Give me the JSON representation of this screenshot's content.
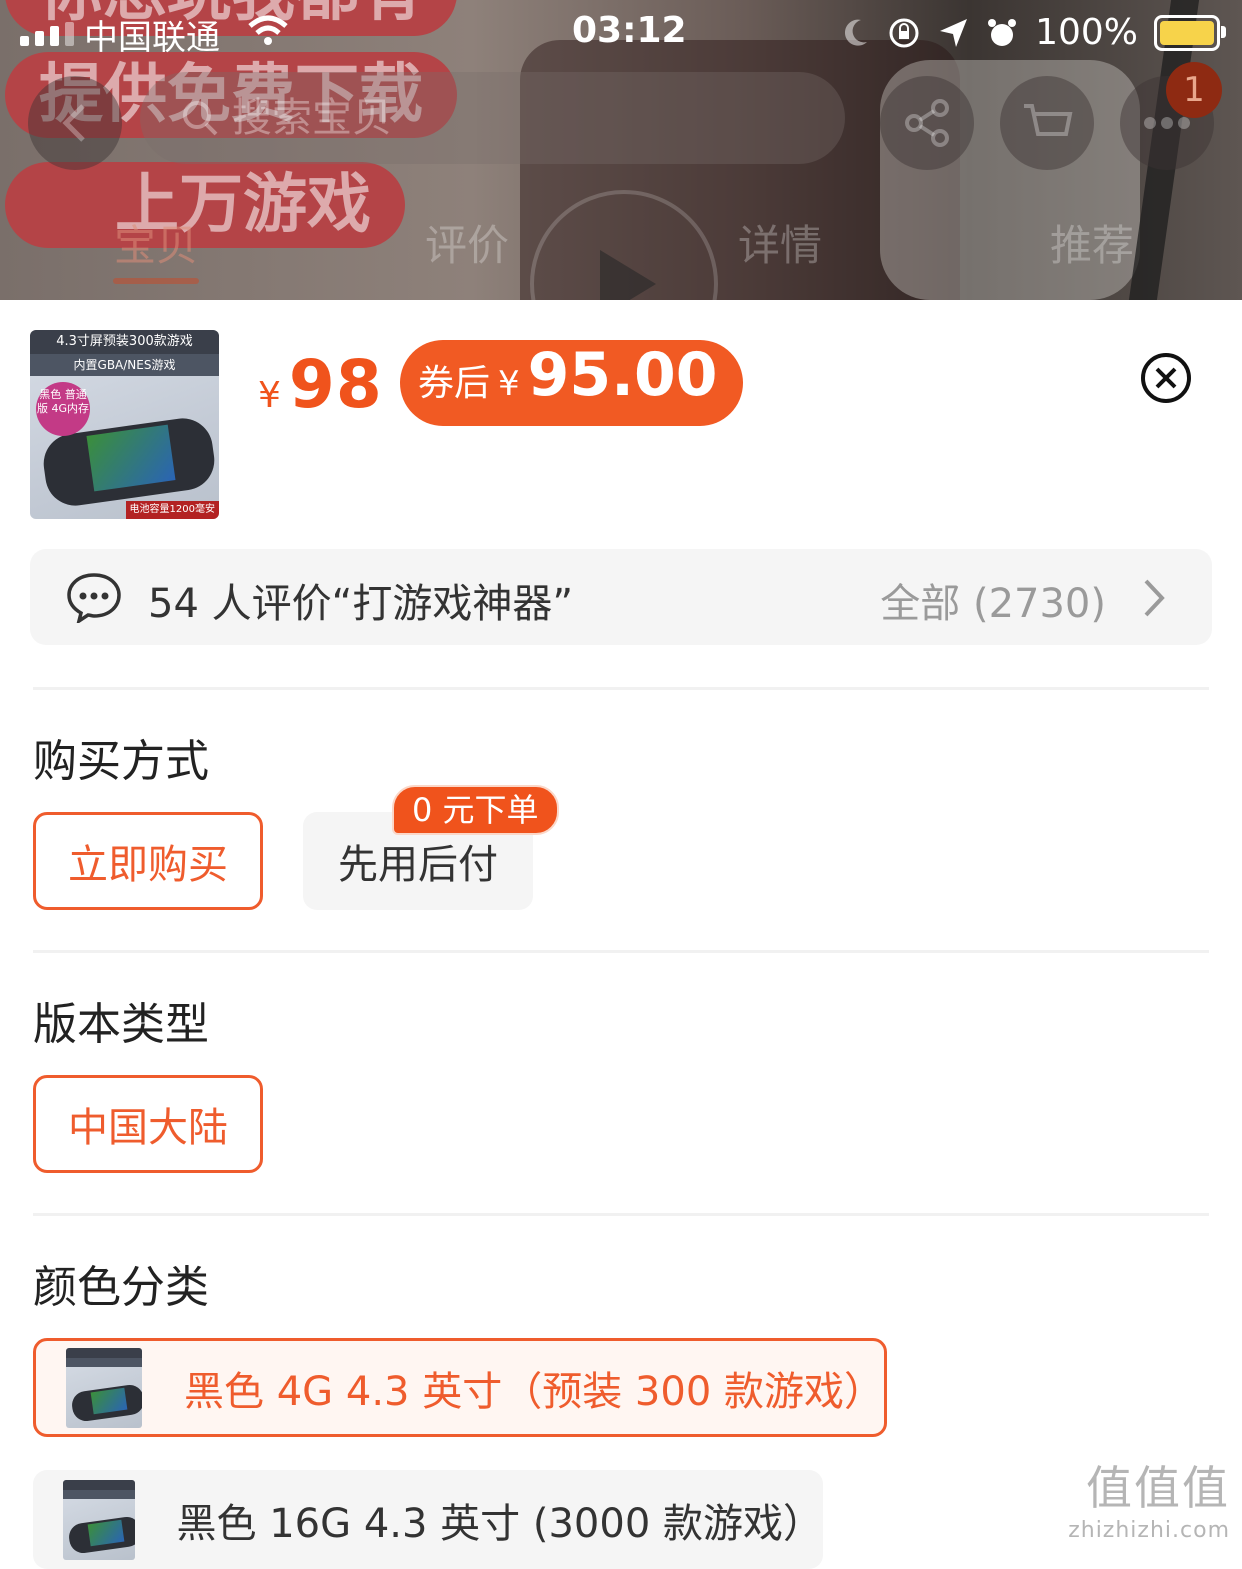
{
  "status_bar": {
    "carrier": "中国联通",
    "time": "03:12",
    "battery_pct": "100%"
  },
  "background": {
    "promo_lines": [
      "你想玩我都有",
      "提供免费下载",
      "上万游戏"
    ],
    "search_placeholder": "搜索宝贝",
    "cart_badge": "1",
    "tabs": [
      "宝贝",
      "评价",
      "详情",
      "推荐"
    ],
    "active_tab": "宝贝"
  },
  "product": {
    "thumbnail": {
      "line1": "4.3寸屏预装300款游戏",
      "line2": "内置GBA/NES游戏",
      "badge": "黑色 普通版 4G内存",
      "footer": "电池容量1200毫安"
    },
    "price_currency": "¥",
    "price": "98",
    "coupon_label": "券后",
    "coupon_currency": "¥",
    "coupon_price": "95.00",
    "accent_color": "#f0531c"
  },
  "reviews": {
    "summary": "54 人评价“打游戏神器”",
    "all_label": "全部 (2730)"
  },
  "purchase_method": {
    "title": "购买方式",
    "options": [
      {
        "label": "立即购买",
        "selected": true
      },
      {
        "label": "先用后付",
        "selected": false,
        "tag": "0 元下单"
      }
    ]
  },
  "version": {
    "title": "版本类型",
    "options": [
      {
        "label": "中国大陆",
        "selected": true
      }
    ]
  },
  "color": {
    "title": "颜色分类",
    "options": [
      {
        "label": "黑色 4G 4.3 英寸（预装 300 款游戏）",
        "selected": true
      },
      {
        "label": "黑色 16G 4.3 英寸 (3000 款游戏）",
        "selected": false
      }
    ]
  },
  "watermark": {
    "text": "值值值",
    "domain": "zhizhizhi.com"
  }
}
